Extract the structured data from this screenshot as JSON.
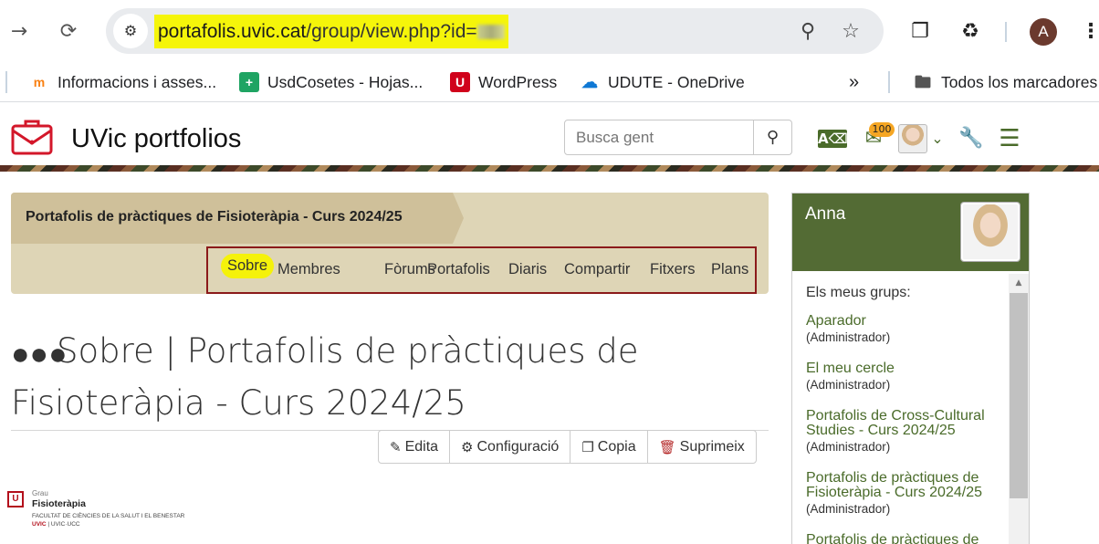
{
  "browser": {
    "url_domain": "portafolis.uvic.cat",
    "url_path": "/group/view.php?id=",
    "bookmarks": [
      {
        "label": "Informacions i asses...",
        "icon": "moodle-icon"
      },
      {
        "label": "UsdCosetes - Hojas...",
        "icon": "sheets-icon"
      },
      {
        "label": "WordPress",
        "icon": "uvic-icon"
      },
      {
        "label": "UDUTE - OneDrive",
        "icon": "onedrive-icon"
      }
    ],
    "all_bookmarks_label": "Todos los marcadores",
    "profile_initial": "A"
  },
  "site": {
    "title": "UVic portfolios",
    "search_placeholder": "Busca gent",
    "inbox_count": "100"
  },
  "group": {
    "title": "Portafolis de pràctiques de Fisioteràpia - Curs 2024/25",
    "tabs": [
      "Sobre",
      "Membres",
      "Fòrums",
      "Portafolis",
      "Diaris",
      "Compartir",
      "Fitxers",
      "Plans"
    ],
    "active_tab": "Sobre"
  },
  "page": {
    "heading": "Sobre | Portafolis de pràctiques de Fisioteràpia - Curs 2024/25",
    "actions": [
      "Edita",
      "Configuració",
      "Copia",
      "Suprimeix"
    ]
  },
  "grau_logo": {
    "small": "Grau",
    "name": "Fisioteràpia",
    "faculty": "FACULTAT DE CIÈNCIES DE LA SALUT I EL BENESTAR",
    "uvic": "UVIC",
    "uvic_rest": "| UVIC·UCC"
  },
  "sidebar": {
    "user_name": "Anna",
    "groups_label": "Els meus grups:",
    "groups": [
      {
        "name": "Aparador",
        "role": "(Administrador)"
      },
      {
        "name": "El meu cercle",
        "role": "(Administrador)"
      },
      {
        "name": "Portafolis de Cross-Cultural Studies - Curs 2024/25",
        "role": "(Administrador)"
      },
      {
        "name": "Portafolis de pràctiques de Fisioteràpia - Curs 2024/25",
        "role": "(Administrador)"
      },
      {
        "name": "Portafolis de pràctiques de",
        "role": ""
      }
    ]
  }
}
